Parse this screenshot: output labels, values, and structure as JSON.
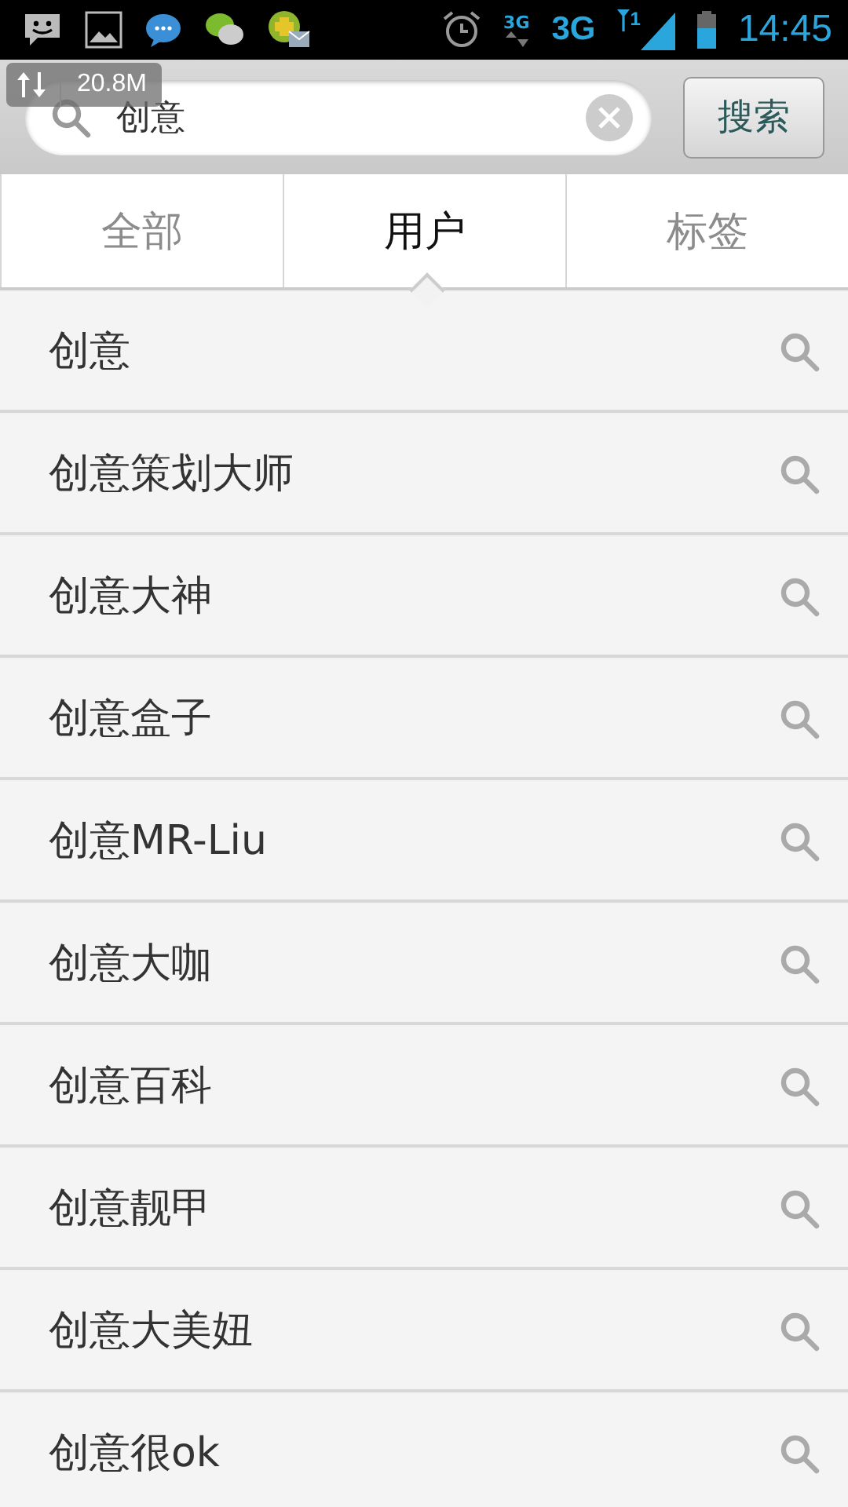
{
  "status_bar": {
    "small_network": "3G",
    "network": "3G",
    "sim": "1",
    "time": "14:45"
  },
  "traffic_overlay": {
    "speed": "20.8M"
  },
  "search": {
    "value": "创意",
    "button": "搜索"
  },
  "tabs": [
    {
      "label": "全部",
      "selected": false
    },
    {
      "label": "用户",
      "selected": true
    },
    {
      "label": "标签",
      "selected": false
    }
  ],
  "results": [
    {
      "label": "创意"
    },
    {
      "label": "创意策划大师"
    },
    {
      "label": "创意大神"
    },
    {
      "label": "创意盒子"
    },
    {
      "label": "创意MR-Liu"
    },
    {
      "label": "创意大咖"
    },
    {
      "label": "创意百科"
    },
    {
      "label": "创意靓甲"
    },
    {
      "label": "创意大美妞"
    },
    {
      "label": "创意很ok"
    }
  ]
}
